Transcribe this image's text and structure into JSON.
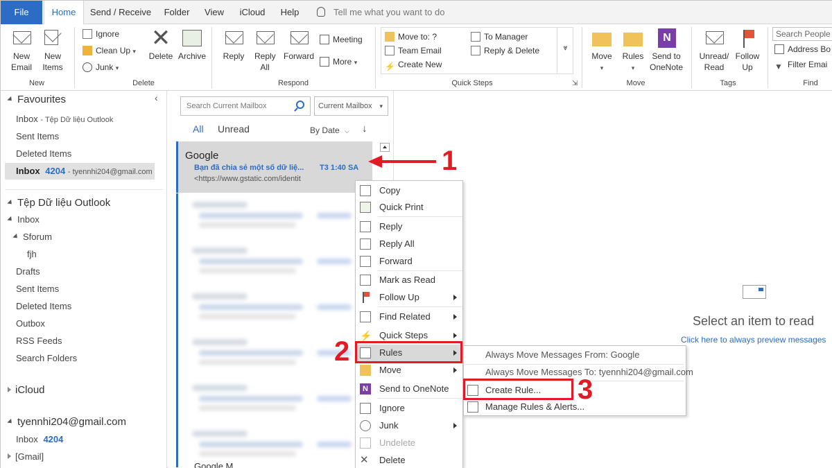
{
  "ribbon_tabs": [
    "File",
    "Home",
    "Send / Receive",
    "Folder",
    "View",
    "iCloud",
    "Help"
  ],
  "tell_me": "Tell me what you want to do",
  "ribbon": {
    "new_email": "New Email",
    "new_items": "New Items",
    "group_new": "New",
    "ignore": "Ignore",
    "clean_up": "Clean Up",
    "junk": "Junk",
    "delete": "Delete",
    "archive": "Archive",
    "group_delete": "Delete",
    "reply": "Reply",
    "reply_all": "Reply All",
    "forward": "Forward",
    "meeting": "Meeting",
    "more": "More",
    "group_respond": "Respond",
    "qs_move_to": "Move to: ?",
    "qs_team_email": "Team Email",
    "qs_create_new": "Create New",
    "qs_to_manager": "To Manager",
    "qs_reply_delete": "Reply & Delete",
    "group_quick_steps": "Quick Steps",
    "move": "Move",
    "rules": "Rules",
    "send_onenote": "Send to OneNote",
    "group_move": "Move",
    "unread_read": "Unread/ Read",
    "follow_up": "Follow Up",
    "group_tags": "Tags",
    "search_people": "Search People",
    "address_book": "Address Bo",
    "filter_email": "Filter Emai",
    "group_find": "Find"
  },
  "nav": {
    "favourites": "Favourites",
    "fav_inbox": "Inbox",
    "fav_inbox_sub": "- Tệp Dữ liệu Outlook",
    "fav_sent": "Sent Items",
    "fav_deleted": "Deleted Items",
    "fav_inbox2": "Inbox",
    "fav_inbox2_count": "4204",
    "fav_inbox2_sub": "- tyennhi204@gmail.com",
    "datafile": "Tệp Dữ liệu Outlook",
    "inbox": "Inbox",
    "sforum": "Sforum",
    "fjh": "fjh",
    "drafts": "Drafts",
    "sent": "Sent Items",
    "deleted": "Deleted Items",
    "outbox": "Outbox",
    "rss": "RSS Feeds",
    "search_folders": "Search Folders",
    "icloud": "iCloud",
    "account": "tyennhi204@gmail.com",
    "acc_inbox": "Inbox",
    "acc_inbox_count": "4204",
    "gmail": "[Gmail]"
  },
  "list": {
    "search_placeholder": "Search Current Mailbox",
    "scope": "Current Mailbox",
    "filter_all": "All",
    "filter_unread": "Unread",
    "sort": "By Date",
    "sort_arrow": "↓",
    "selected_from": "Google",
    "selected_subject": "Bạn đã chia sẻ một số dữ liệ...",
    "selected_time": "T3 1:40 SA",
    "selected_preview": "<https://www.gstatic.com/identit",
    "bottom_partial": "Google M"
  },
  "reading": {
    "title": "Select an item to read",
    "link": "Click here to always preview messages"
  },
  "context_menu": [
    "Copy",
    "Quick Print",
    "Reply",
    "Reply All",
    "Forward",
    "Mark as Read",
    "Follow Up",
    "Find Related",
    "Quick Steps",
    "Rules",
    "Move",
    "Send to OneNote",
    "Ignore",
    "Junk",
    "Undelete",
    "Delete"
  ],
  "rules_submenu": [
    "Always Move Messages From: Google",
    "Always Move Messages To: tyennhi204@gmail.com",
    "Create Rule...",
    "Manage Rules & Alerts..."
  ],
  "annotations": [
    "1",
    "2",
    "3"
  ],
  "colors": {
    "accent": "#2b6cc4",
    "annotation": "#e01b24"
  }
}
